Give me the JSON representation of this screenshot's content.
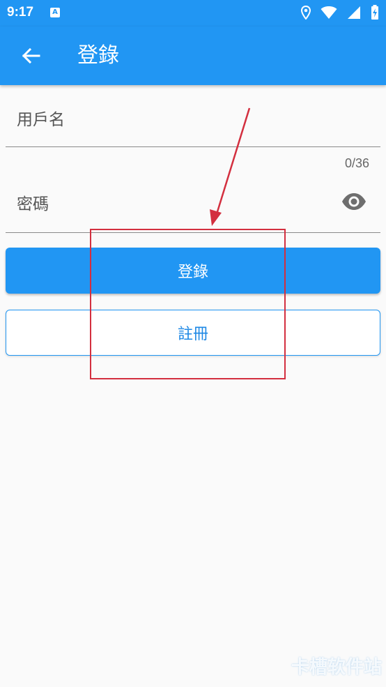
{
  "status_bar": {
    "time": "9:17",
    "notification_icon": "app-store-icon",
    "icons": [
      "location-icon",
      "wifi-icon",
      "signal-icon",
      "battery-charging-icon"
    ]
  },
  "app_bar": {
    "title": "登錄",
    "back_icon": "arrow-left-icon",
    "color": "#2196f3"
  },
  "form": {
    "username": {
      "label": "用戶名",
      "value": ""
    },
    "password": {
      "label": "密碼",
      "value": "",
      "counter": "0/36",
      "visibility_icon": "eye-icon"
    }
  },
  "buttons": {
    "login_label": "登錄",
    "register_label": "註冊"
  },
  "annotation": {
    "color": "#d32f3f"
  },
  "watermark": {
    "text": "卡槽软件站"
  }
}
